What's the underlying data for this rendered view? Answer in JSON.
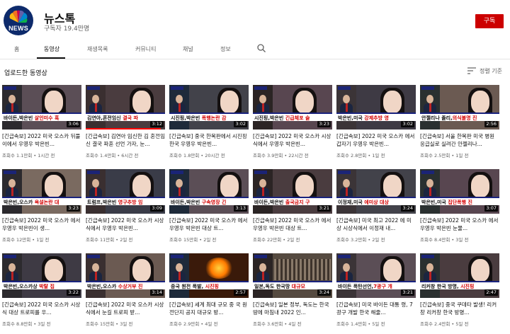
{
  "channel": {
    "name": "뉴스톡",
    "subscribers": "구독자 19.4만명",
    "logo_text": "NEWS",
    "subscribe_label": "구독",
    "brand_color": "#0d2a6b",
    "subscribe_color": "#cc0000"
  },
  "tabs": [
    {
      "label": "홈",
      "active": false
    },
    {
      "label": "동영상",
      "active": true
    },
    {
      "label": "재생목록",
      "active": false
    },
    {
      "label": "커뮤니티",
      "active": false
    },
    {
      "label": "채널",
      "active": false
    },
    {
      "label": "정보",
      "active": false
    }
  ],
  "search_icon": "search-icon",
  "section": {
    "title": "업로드한 동영상",
    "sort_label": "정렬 기준",
    "sort_icon": "sort-icon"
  },
  "videos": [
    {
      "banner_white": "바이든,박은빈 ",
      "banner_red": "살인미수 혹",
      "duration": "3:06",
      "title": "[긴급속보] 2022 미국 오스카 뒤풀이에서 우영우 박은빈...",
      "meta": "조회수 1.1만회 • 1시간 전",
      "watched": 0
    },
    {
      "banner_white": "김연아,혼전임신 ",
      "banner_red": "결국 파",
      "duration": "3:12",
      "title": "[긴급속보] 김연아 임신한 김 혼전임신 결국 파혼 선언 가자, 눈...",
      "meta": "조회수 1.4만회 • 6시간 전",
      "watched": 0.95
    },
    {
      "banner_white": "시진핑,박은빈 ",
      "banner_red": "폭행논란 감",
      "duration": "3:02",
      "title": "[긴급속보] 중국 한복판에서 시진핑 한국 우영우 박은빈...",
      "meta": "조회수 1.8만회 • 20시간 전",
      "watched": 0
    },
    {
      "banner_white": "시진핑,박은빈 ",
      "banner_red": "긴급체포 술",
      "duration": "3:23",
      "title": "[긴급속보] 2022 미국 오스카 시상식에서 우영우 박은빈...",
      "meta": "조회수 3.9만회 • 22시간 전",
      "watched": 0
    },
    {
      "banner_white": "박은빈,미국 ",
      "banner_red": "강제추방 영",
      "duration": "3:02",
      "title": "[긴급속보] 2022 미국 오스카 에서 갑자기 우영우 박은빈...",
      "meta": "조회수 2.8만회 • 1일 전",
      "watched": 0
    },
    {
      "banner_white": "안젤리나 졸리,",
      "banner_red": "의식불명 진",
      "duration": "2:56",
      "title": "[긴급속보] 서울 한복판 미국 병원 응급실로 실려간 안젤리나...",
      "meta": "조회수 2.5만회 • 1일 전",
      "watched": 0
    },
    {
      "banner_white": "박은빈,오스카 ",
      "banner_red": "욕설논란 대",
      "duration": "3:23",
      "title": "[긴급속보] 2022 미국 오스카 에서 우영우 박은빈이 생...",
      "meta": "조회수 12만회 • 1일 전",
      "watched": 0
    },
    {
      "banner_white": "트럼프,박은빈 ",
      "banner_red": "영구추방 임",
      "duration": "3:09",
      "title": "[긴급속보] 2022 미국 오스카 시상식에서 우영우 박은빈...",
      "meta": "조회수 11만회 • 2일 전",
      "watched": 0
    },
    {
      "banner_white": "바이든,박은빈 ",
      "banner_red": "구속영장 긴",
      "duration": "3:13",
      "title": "[긴급속보] 2022 미국 오스카 에서 우영우 박은빈 대상 트...",
      "meta": "조회수 15만회 • 2일 전",
      "watched": 0
    },
    {
      "banner_white": "바이든,박은빈 ",
      "banner_red": "출국금지 구",
      "duration": "3:21",
      "title": "[긴급속보] 2022 미국 오스카 에서 우영우 박은빈 대상 트...",
      "meta": "조회수 22만회 • 2일 전",
      "watched": 0
    },
    {
      "banner_white": "이정재,미국 ",
      "banner_red": "에미상 대상",
      "duration": "3:24",
      "title": "[긴급속보] 미국 최고 2022 에 미상 시상식에서 이정재 내...",
      "meta": "조회수 3.2만회 • 2일 전",
      "watched": 0
    },
    {
      "banner_white": "박은빈,미국 ",
      "banner_red": "집단폭행 진",
      "duration": "3:07",
      "title": "[긴급속보] 2022 미국 오스카 에서 우영우 박은빈 눈물...",
      "meta": "조회수 8.4만회 • 3일 전",
      "watched": 0
    },
    {
      "banner_white": "박은빈,오스카상 ",
      "banner_red": "박탈 집",
      "duration": "3:22",
      "title": "[긴급속보] 2022 미국 오스카 시상식 대상 트로피를 우...",
      "meta": "조회수 8.8만회 • 3일 전",
      "watched": 0
    },
    {
      "banner_white": "박은빈,오스카 ",
      "banner_red": "수상거부 진",
      "duration": "3:14",
      "title": "[긴급속보] 2022 미국 오스카 시상식에서 눈길 트로피 받...",
      "meta": "조회수 15만회 • 3일 전",
      "watched": 0
    },
    {
      "banner_white": "중국 원전 폭발, ",
      "banner_red": "시진핑",
      "duration": "2:57",
      "title": "[긴급속보] 세계 최대 규모 중 국 원전단지 공지 대규모 방...",
      "meta": "조회수 2.9만회 • 4일 전",
      "watched": 0
    },
    {
      "banner_white": "일본,독도 한국땅 ",
      "banner_red": "대규모",
      "duration": "3:24",
      "title": "[긴급속보] 일본 정부, 독도는 한국 땅에 마침내 2022 인...",
      "meta": "조회수 3.6만회 • 4일 전",
      "watched": 0
    },
    {
      "banner_white": "바이든 폭탄선언,",
      "banner_red": "7광구 개",
      "duration": "3:21",
      "title": "[긴급속보] 미국 바이든 대통 령, 7광구 개발 한국 해줄...",
      "meta": "조회수 1.4만회 • 5일 전",
      "watched": 0
    },
    {
      "banner_white": "리커창 한국 방명, ",
      "banner_red": "시진핑",
      "duration": "2:47",
      "title": "[긴급속보] 중국 쿠데타 발생! 리커창 리커창 한국 방명...",
      "meta": "조회수 2.4만회 • 5일 전",
      "watched": 0
    }
  ]
}
